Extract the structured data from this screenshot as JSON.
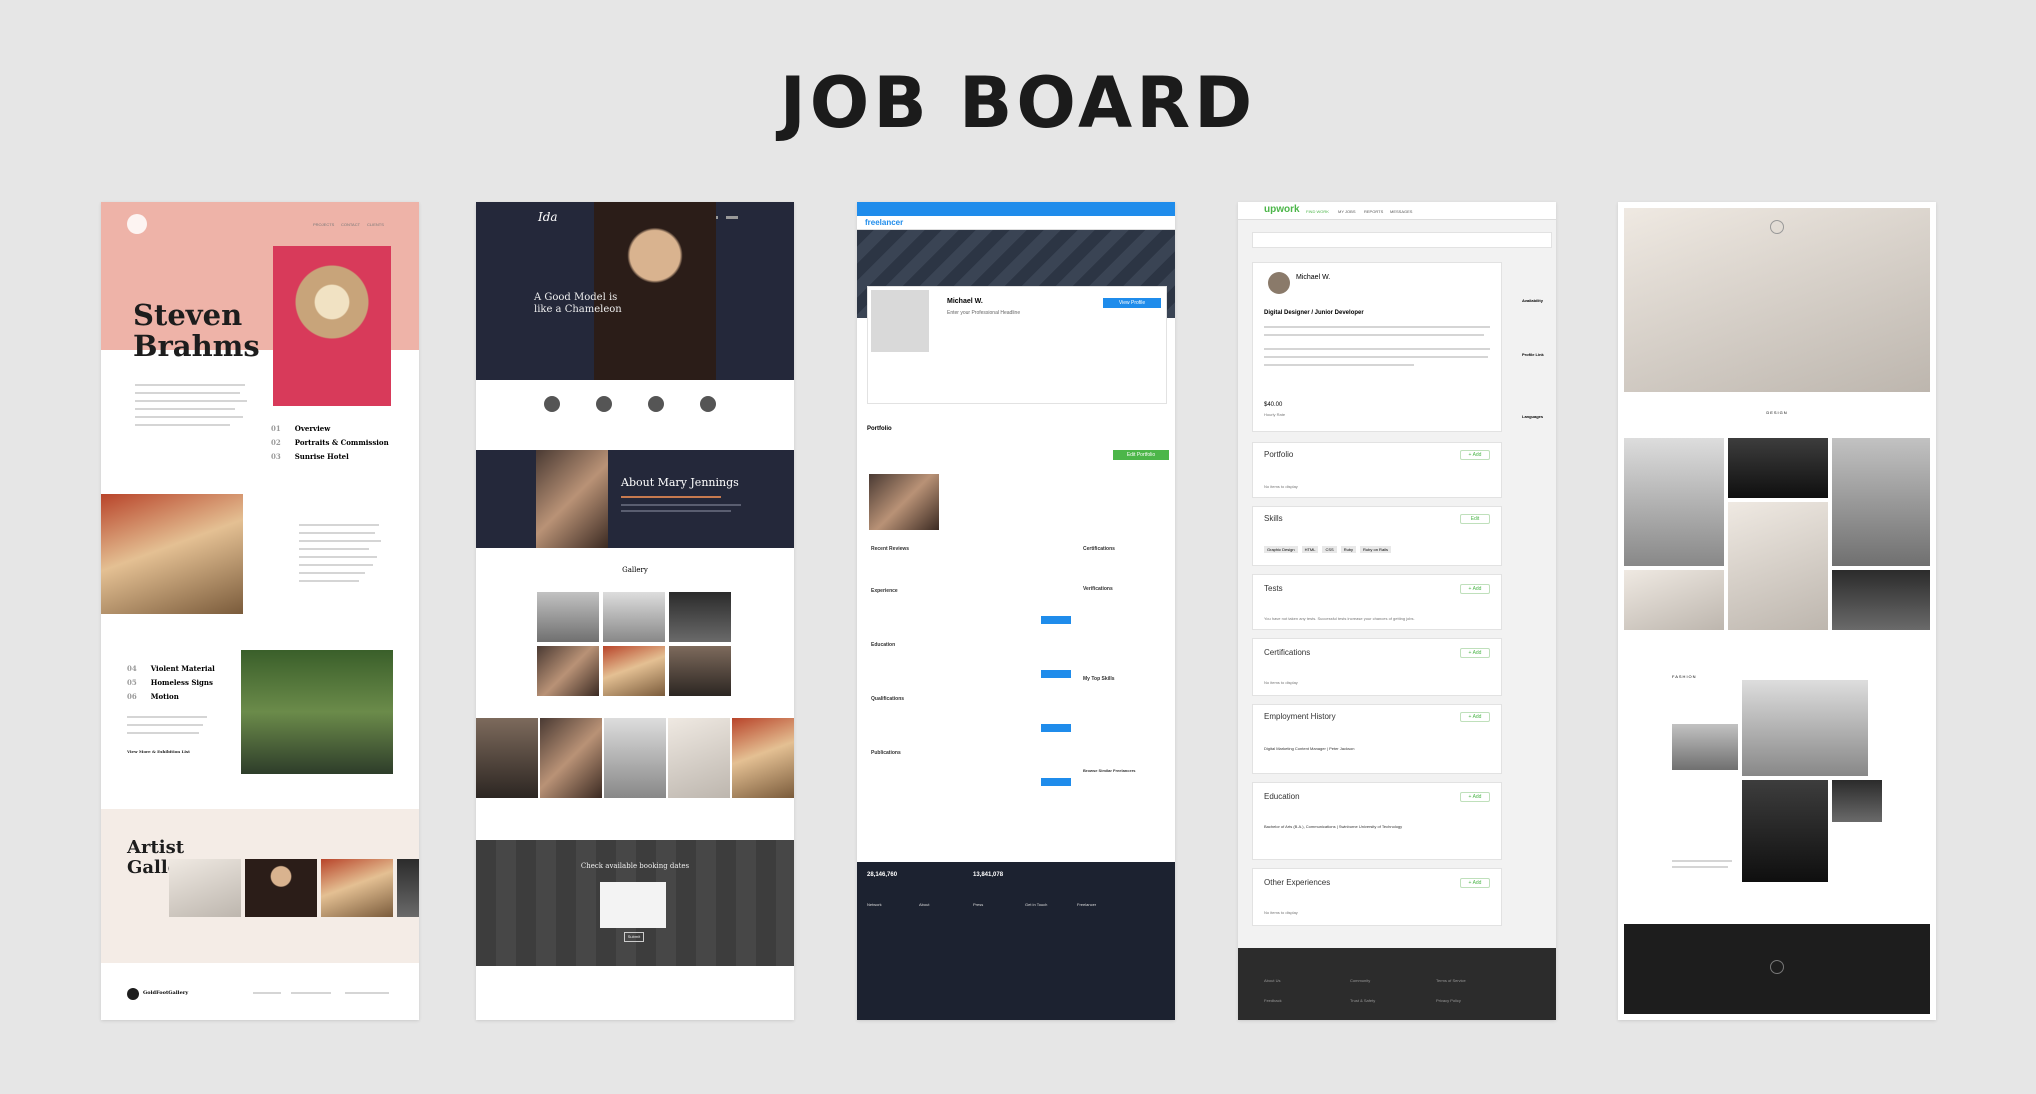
{
  "page": {
    "title": "JOB BOARD"
  },
  "colors": {
    "background": "#e6e6e6",
    "pink": "#eeb3a8",
    "navy": "#24283a",
    "freelancer_blue": "#1f8ceb",
    "upwork_green": "#4cb649"
  },
  "card1": {
    "name": "Steven Brahms",
    "nav": [
      "PROJECTS",
      "CONTACT",
      "CLIENTS"
    ],
    "list_a": [
      {
        "num": "01",
        "label": "Overview"
      },
      {
        "num": "02",
        "label": "Portraits & Commission"
      },
      {
        "num": "03",
        "label": "Sunrise Hotel"
      }
    ],
    "list_b": [
      {
        "num": "04",
        "label": "Violent Material"
      },
      {
        "num": "05",
        "label": "Homeless Signs"
      },
      {
        "num": "06",
        "label": "Motion"
      }
    ],
    "link": "View More & Exhibition List",
    "gallery_title": "Artist Gallery",
    "footer_logo": "GoldFootGallery"
  },
  "card2": {
    "logo": "Ida",
    "hero_text": "A Good Model is like a Chameleon",
    "about_title": "About Mary Jennings",
    "gallery_title": "Gallery",
    "booking_title": "Check available booking dates",
    "submit": "Submit"
  },
  "card3": {
    "brand": "freelancer",
    "profile_name": "Michael W.",
    "headline_placeholder": "Enter your Professional Headline",
    "view_profile": "View Profile",
    "portfolio": "Portfolio",
    "edit_portfolio": "Edit Portfolio",
    "sections": [
      "Recent Reviews",
      "Experience",
      "Education",
      "Qualifications",
      "Publications"
    ],
    "side_sections": [
      "Certifications",
      "Verifications",
      "My Top Skills",
      "Browse Similar Freelancers"
    ],
    "stat_1": "28,146,760",
    "stat_2": "13,841,078",
    "footer_cols": [
      "Network",
      "About",
      "Press",
      "Get in Touch",
      "Freelancer"
    ]
  },
  "card4": {
    "brand": "upwork",
    "nav": [
      "FIND WORK",
      "MY JOBS",
      "REPORTS",
      "MESSAGES"
    ],
    "name": "Michael W.",
    "title": "Digital Designer / Junior Developer",
    "rate": "$40.00",
    "rate_label": "Hourly Rate",
    "sections": [
      {
        "title": "Portfolio",
        "body": "No items to display",
        "action": "+ Add"
      },
      {
        "title": "Skills",
        "body": "",
        "action": "Edit"
      },
      {
        "title": "Tests",
        "body": "You have not taken any tests. Successful tests increase your chances of getting jobs.",
        "action": "+ Add"
      },
      {
        "title": "Certifications",
        "body": "No items to display",
        "action": "+ Add"
      },
      {
        "title": "Employment History",
        "body": "Digital Marketing Content Manager | Peter Jackson",
        "action": "+ Add"
      },
      {
        "title": "Education",
        "body": "Bachelor of Arts (B.A.), Communications | Swinburne University of Technology",
        "action": "+ Add"
      },
      {
        "title": "Other Experiences",
        "body": "No items to display",
        "action": "+ Add"
      }
    ],
    "skills": [
      "Graphic Design",
      "HTML",
      "CSS",
      "Ruby",
      "Ruby on Rails"
    ],
    "side": [
      "Availability",
      "Profile Link",
      "Languages"
    ],
    "footer": [
      "About Us",
      "Community",
      "Terms of Service",
      "Feedback",
      "Trust & Safety",
      "Privacy Policy"
    ]
  },
  "card5": {
    "section_label": "DESIGN",
    "section_label_2": "FASHION"
  }
}
